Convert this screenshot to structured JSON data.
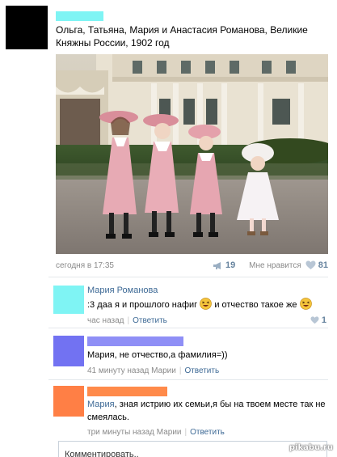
{
  "post": {
    "caption": "Ольга, Татьяна, Мария и Анастасия Романова, Великие Княжны России, 1902 год",
    "mask_color": "#7ff4f4",
    "date": "сегодня в 17:35",
    "share_count": "19",
    "like_label": "Мне нравится",
    "like_count": "81"
  },
  "comments": [
    {
      "author": "Мария Романова",
      "text_before": ":3 даа я и прошлого нафиг",
      "text_middle": "и отчество такое же",
      "time": "час назад",
      "reply_label": "Ответить",
      "like_count": "1",
      "avatar_color": "#7ff4f4"
    },
    {
      "author_mask_color": "#8f8ff6",
      "text": "Мария, не отчество,а фамилия=))",
      "time": "41 минуту назад Марии",
      "reply_label": "Ответить",
      "avatar_color": "#7272f2"
    },
    {
      "author_mask_color": "#ff8a4a",
      "addressee": "Мария",
      "text": ", зная истрию их семьи,я бы на твоем месте так не смеялась.",
      "time": "три минуты назад Марии",
      "reply_label": "Ответить",
      "avatar_color": "#ff7f45"
    }
  ],
  "comment_input": {
    "placeholder": "Комментировать.."
  },
  "watermark": "pikabu.ru"
}
